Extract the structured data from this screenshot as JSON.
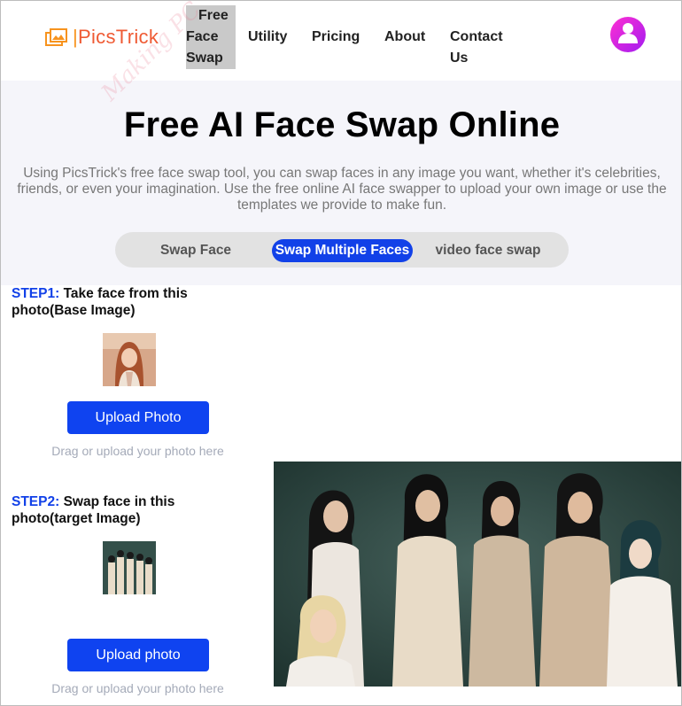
{
  "header": {
    "logo_text": "PicsTrick",
    "logo_pipe": "|",
    "nav": {
      "free_face_swap": [
        "Free",
        "Face",
        "Swap"
      ],
      "utility": "Utility",
      "pricing": "Pricing",
      "about": "About",
      "contact": [
        "Contact",
        "Us"
      ]
    },
    "avatar_icon": "user-avatar-icon",
    "brand_color": "#ef5a33"
  },
  "hero": {
    "title": "Free AI Face Swap Online",
    "description": "Using PicsTrick's free face swap tool, you can swap faces in any image you want, whether it's celebrities, friends, or even your imagination. Use the free online AI face swapper to upload your own image or use the templates we provide to make fun.",
    "tabs": [
      {
        "label": "Swap Face",
        "active": false
      },
      {
        "label": "Swap Multiple Faces",
        "active": true
      },
      {
        "label": "video face swap",
        "active": false
      }
    ],
    "accent_color": "#1241e8"
  },
  "step1": {
    "label": "STEP1:",
    "text": "Take face from this photo(Base Image)",
    "button": "Upload Photo",
    "hint": "Drag or upload your photo here"
  },
  "step2": {
    "label": "STEP2:",
    "text": "Swap face in this photo(target Image)",
    "button": "Upload photo",
    "hint": "Drag or upload your photo here"
  }
}
